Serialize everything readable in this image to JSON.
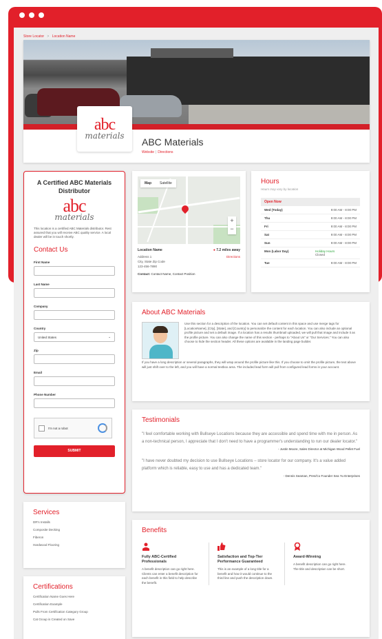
{
  "breadcrumb": {
    "store_locator": "Store Locator",
    "sep": ">",
    "location_name": "Location Name"
  },
  "hero": {
    "logo_abc": "abc",
    "logo_materials": "materials",
    "title": "ABC Materials",
    "website": "Website",
    "sep": "|",
    "directions": "Directions"
  },
  "contact": {
    "title": "A Certified ABC Materials Distributor",
    "logo_abc": "abc",
    "logo_materials": "materials",
    "description": "This location is a certified ABC Materials distributor. Rest assured that you will receive ABC quality service. A local dealer will be in touch shortly.",
    "heading": "Contact Us",
    "first_name": "First Name",
    "last_name": "Last Name",
    "company": "Company",
    "country": "Country",
    "country_value": "United States",
    "zip": "Zip",
    "email": "Email",
    "phone": "Phone Number",
    "captcha": "I'm not a robot",
    "submit": "SUBMIT"
  },
  "map": {
    "tab_map": "Map",
    "tab_satellite": "Satellite",
    "location_name": "Location Name",
    "distance": "7.2 miles away",
    "address1": "Address 1",
    "city": "City, State Zip Code",
    "phone": "123-456-7890",
    "directions": "Directions",
    "contact_label": "Contact:",
    "contact_value": "Contact Name, Contact Position"
  },
  "hours": {
    "title": "Hours",
    "subtitle": "Hours may vary by location",
    "open_now": "Open Now",
    "rows": [
      {
        "day": "Wed (Today)",
        "time": "9:00 AM - 8:00 PM"
      },
      {
        "day": "Thu",
        "time": "9:00 AM - 8:00 PM"
      },
      {
        "day": "Fri",
        "time": "9:00 AM - 8:00 PM"
      },
      {
        "day": "Sat",
        "time": "9:00 AM - 8:00 PM"
      },
      {
        "day": "Sun",
        "time": "9:00 AM - 8:00 PM"
      },
      {
        "day": "Mon (Labor Day)",
        "time": "Holiday Hours",
        "time2": "Closed"
      },
      {
        "day": "Tue",
        "time": "9:00 AM - 8:00 PM"
      }
    ]
  },
  "about": {
    "title": "About ABC Materials",
    "text1": "Use this section for a description of the location. You can set default content in this space and use merge tags for [LocationName], [City], [State], and [Country] to personalize the content for each location. You can also include an optional profile picture and set a default image. If a location has a results thumbnail uploaded, we will pull that image and include it as the profile picture. You can also change the name of this section - perhaps to \"About Us\" or \"Our Services.\" You can also choose to hide the section header. All these options are available in the landing page builder.",
    "text2": "If you have a long description or several paragraphs, they will wrap around the profile picture like this. If you choose to omit the profile picture, the text above will just shift over to the left, and you will have a normal textbox area. The included lead form will pull from configured lead forms in your account."
  },
  "testimonials": {
    "title": "Testimonials",
    "q1": "\"I feel comfortable working with Bullseye Locations because they are accessible and spend time with me in person. As a non-technical person, I appreciate that I don't need to have a programmer's understanding to run our dealer locator.\"",
    "a1": "- Justin Moore, Sales Director at Michigan Wood Pellet Fuel",
    "q2": "\"I have never doubted my decision to use Bullseye Locations – store locator for our company. It's a value added platform which is reliable, easy to use and has a dedicated team.\"",
    "a2": "- Dennis Seaman, Pres/Co Founder Sea Yu Enterprises"
  },
  "services": {
    "title": "Services",
    "items": [
      "DR's Installs",
      "Composite Decking",
      "Fiberon",
      "Hardwood Flooring"
    ]
  },
  "certifications": {
    "title": "Certifications",
    "items": [
      "Certification Name Goes Here",
      "Certification Example",
      "Pulls From Certification Category Group",
      "Cat Group is Created on Save"
    ]
  },
  "benefits": {
    "title": "Benefits",
    "items": [
      {
        "name": "Fully ABC-Certified Professionals",
        "desc": "A benefit description can go right here. Clients can enter a benefit description for each benefit in this field to help describe the benefit."
      },
      {
        "name": "Satisfaction and Top-Tier Performance Guaranteed",
        "desc": "This is an example of a long title for a benefit and how it would continue to the third line and push the description down."
      },
      {
        "name": "Award-Winning",
        "desc": "A benefit description can go right here. The title and description can be short."
      }
    ]
  },
  "colors": {
    "accent": "#e2202a"
  }
}
